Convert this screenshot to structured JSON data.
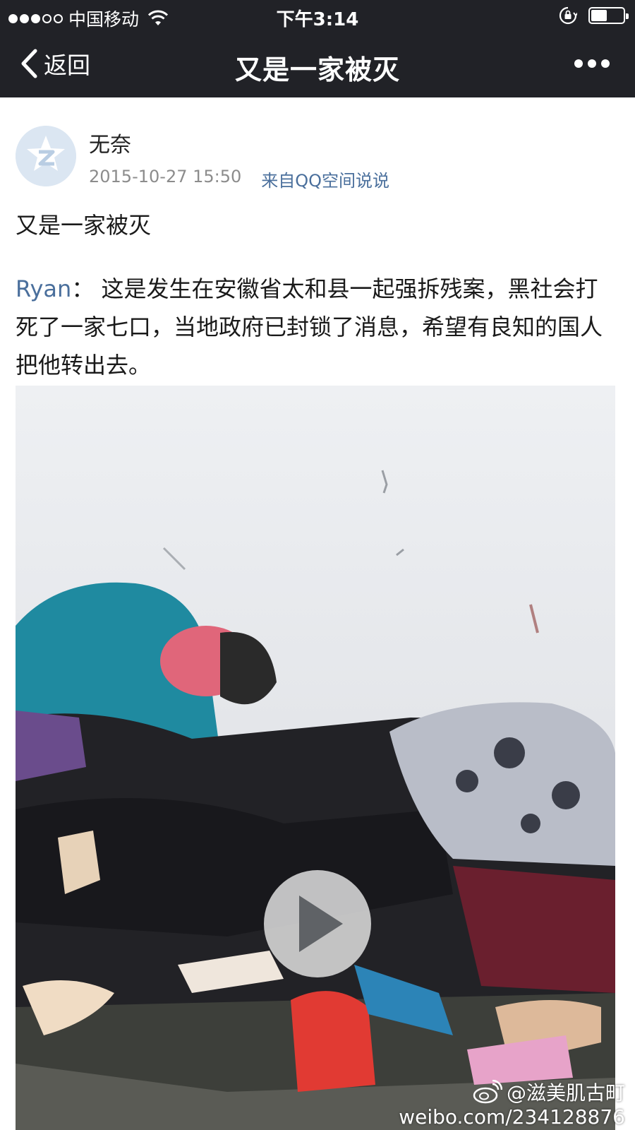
{
  "status_bar": {
    "carrier": "中国移动",
    "time": "下午3:14",
    "signal_bars_filled": 3,
    "signal_bars_total": 5,
    "battery_level": 0.5
  },
  "nav": {
    "back_label": "返回",
    "title": "又是一家被灭"
  },
  "post": {
    "username": "无奈",
    "timestamp": "2015-10-27 15:50",
    "source": "来自QQ空间说说",
    "title": "又是一家被灭",
    "body_author": "Ryan",
    "body_separator": "：",
    "body_text": "这是发生在安徽省太和县一起强拆残案，黑社会打死了一家七口，当地政府已封锁了消息，希望有良知的国人把他转出去。"
  },
  "video": {
    "watermark_handle": "@滋美肌古町",
    "watermark_url": "weibo.com/234128876"
  },
  "colors": {
    "bar_background": "#212227",
    "link_blue": "#4a6f9c",
    "meta_gray": "#8c8c8c"
  },
  "icons": {
    "back": "chevron-left-icon",
    "more": "more-dots-icon",
    "wifi": "wifi-icon",
    "rotation_lock": "rotation-lock-icon",
    "play": "play-icon",
    "avatar": "qzone-logo-icon",
    "watermark": "weibo-icon"
  }
}
